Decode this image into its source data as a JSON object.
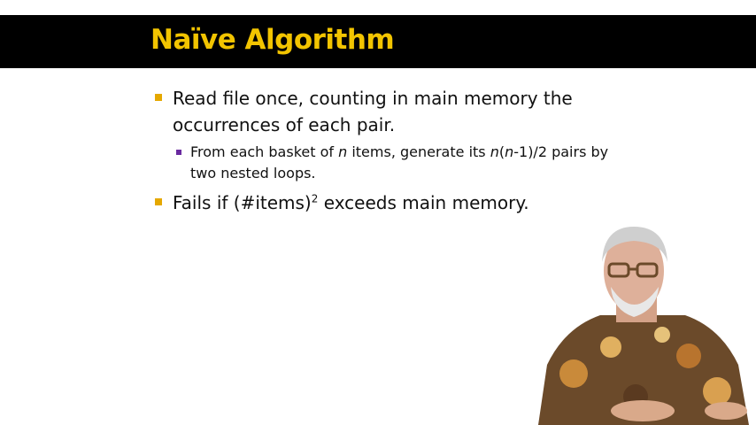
{
  "slide": {
    "title": "Naïve Algorithm",
    "bullets": [
      {
        "text": "Read file once, counting in main memory the occurrences of each pair.",
        "sub_bullets": [
          {
            "part1": "From each basket of ",
            "n1": "n",
            "part2": " items, generate its  ",
            "n2": "n",
            "part3": "(",
            "n3": "n",
            "part4": "-1)/2 pairs by two nested loops."
          }
        ]
      },
      {
        "part1": "Fails if (#items)",
        "superscript": "2",
        "part2": " exceeds main memory."
      }
    ]
  },
  "colors": {
    "title_bar": "#000000",
    "title_text": "#f2c400",
    "bullet_l1_marker": "#e5a800",
    "bullet_l2_marker": "#6a2aa0"
  },
  "speaker_video": {
    "description_icon": "presenter-video-icon"
  }
}
